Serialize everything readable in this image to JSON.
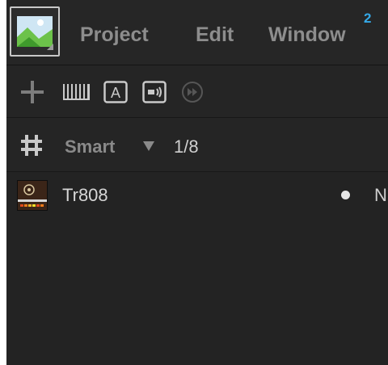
{
  "menubar": {
    "app_icon": "image-icon",
    "items": [
      "Project",
      "Edit",
      "Window"
    ],
    "window_badge": "2",
    "badge_color": "#35a9e8"
  },
  "toolbar": {
    "tools": [
      "plus-icon",
      "barcode-icon",
      "text-a-icon",
      "speaker-box-icon",
      "fast-forward-circle-icon"
    ],
    "text_tool_label": "A"
  },
  "filter": {
    "grid_icon": "hash-grid-icon",
    "mode": "Smart",
    "page": "1/8"
  },
  "list": {
    "items": [
      {
        "name": "Tr808",
        "trailing": "N",
        "thumbnail": "drum-machine-thumbnail"
      }
    ]
  }
}
